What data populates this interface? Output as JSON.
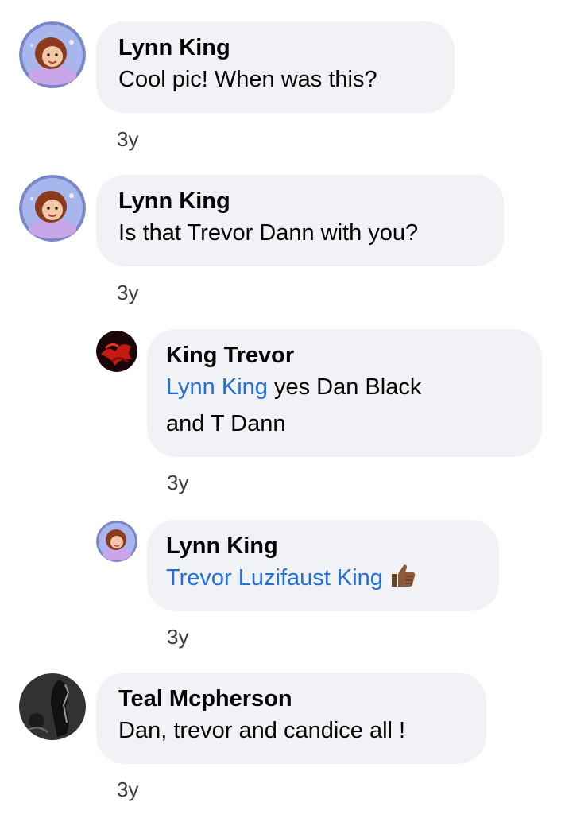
{
  "comments": [
    {
      "author": "Lynn King",
      "text": "Cool pic! When was this?",
      "time": "3y"
    },
    {
      "author": "Lynn King",
      "text": "Is that Trevor Dann with you?",
      "time": "3y"
    },
    {
      "author": "King Trevor",
      "mention": "Lynn King",
      "text_line1": " yes  Dan Black",
      "text_line2": "and T Dann",
      "time": "3y"
    },
    {
      "author": "Lynn King",
      "mention": "Trevor Luzifaust King",
      "emoji": "thumbs-up-icon",
      "time": "3y"
    },
    {
      "author": "Teal Mcpherson",
      "text": "Dan, trevor and candice all !",
      "time": "3y"
    }
  ],
  "colors": {
    "bubble": "#f0f2f5",
    "mention": "#216fdb",
    "text": "#050505",
    "time": "#3a3b3c"
  }
}
